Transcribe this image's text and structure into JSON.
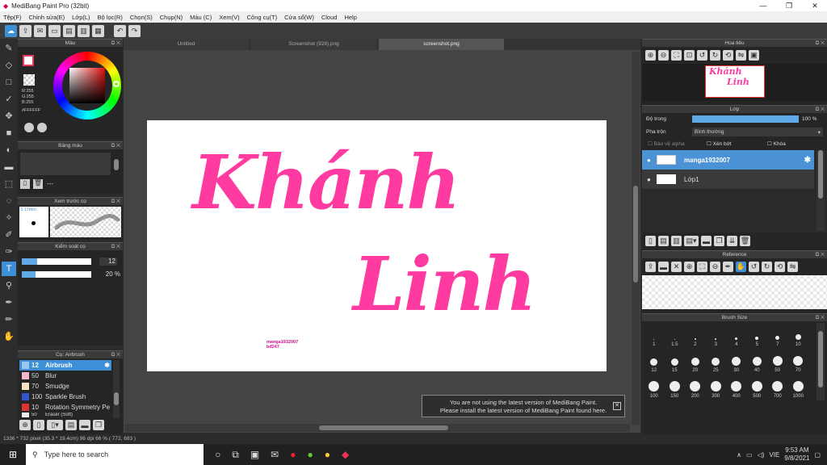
{
  "window": {
    "title": "MediBang Paint Pro (32bit)"
  },
  "menu": [
    "Tệp(F)",
    "Chỉnh sửa(E)",
    "Lớp(L)",
    "Bộ lọc(R)",
    "Chọn(S)",
    "Chụp(N)",
    "Màu (C)",
    "Xem(V)",
    "Công cụ(T)",
    "Cửa sổ(W)",
    "Cloud",
    "Help"
  ],
  "tabs": [
    "Untitled",
    "Screenshot (928).png",
    "screenshot.png"
  ],
  "color_panel": {
    "title": "Màu",
    "rgb": [
      "R:255",
      "G:255",
      "B:255"
    ],
    "hex": "#FFFFFF"
  },
  "palette": {
    "title": "Bảng màu",
    "text": "---"
  },
  "brush_preview": {
    "title": "Xem trước cọ",
    "size": "3.17mm"
  },
  "brush_control": {
    "title": "Kiểm soát cọ",
    "size": "12",
    "opacity": "20 %"
  },
  "brush_list": {
    "title": "Cọ: Airbrush",
    "items": [
      {
        "size": "12",
        "name": "Airbrush"
      },
      {
        "size": "50",
        "name": "Blur"
      },
      {
        "size": "70",
        "name": "Smudge"
      },
      {
        "size": "100",
        "name": "Sparkle Brush"
      },
      {
        "size": "10",
        "name": "Rotation Symmetry Pe"
      },
      {
        "size": "50",
        "name": "Eraser (Soft)"
      }
    ]
  },
  "canvas": {
    "line1": "Khánh",
    "line2": "Linh",
    "watermark1": "manga1932007",
    "watermark2": "bđ247"
  },
  "navigator": {
    "title": "Hoa tiêu"
  },
  "layers": {
    "title": "Lớp",
    "opacity_label": "Độ trong",
    "opacity_value": "100 %",
    "blend_label": "Pha trộn",
    "blend_value": "Bình thường",
    "opt1": "Bảo vệ alpha",
    "opt2": "Xén bớt",
    "opt3": "Khóa",
    "items": [
      {
        "name": "manga1932007"
      },
      {
        "name": "Lớp1"
      }
    ]
  },
  "reference": {
    "title": "Reference"
  },
  "brush_size": {
    "title": "Brush Size",
    "row1": [
      "1",
      "1.5",
      "2",
      "3",
      "4",
      "5",
      "7",
      "10"
    ],
    "row2": [
      "12",
      "15",
      "20",
      "25",
      "30",
      "40",
      "50",
      "70"
    ],
    "row3": [
      "100",
      "150",
      "200",
      "300",
      "400",
      "500",
      "700",
      "1000"
    ]
  },
  "notice": {
    "line1": "You are not using the latest version of MediBang Paint.",
    "line2": "Please install the latest version of MediBang Paint found here."
  },
  "status": "1336 * 732 pixel   (35.3 * 19.4cm)   96 dpi   66 %   ( 772, 683 )",
  "taskbar": {
    "search": "Type here to search",
    "lang": "VIE",
    "time": "9:53 AM",
    "date": "9/8/2021"
  }
}
